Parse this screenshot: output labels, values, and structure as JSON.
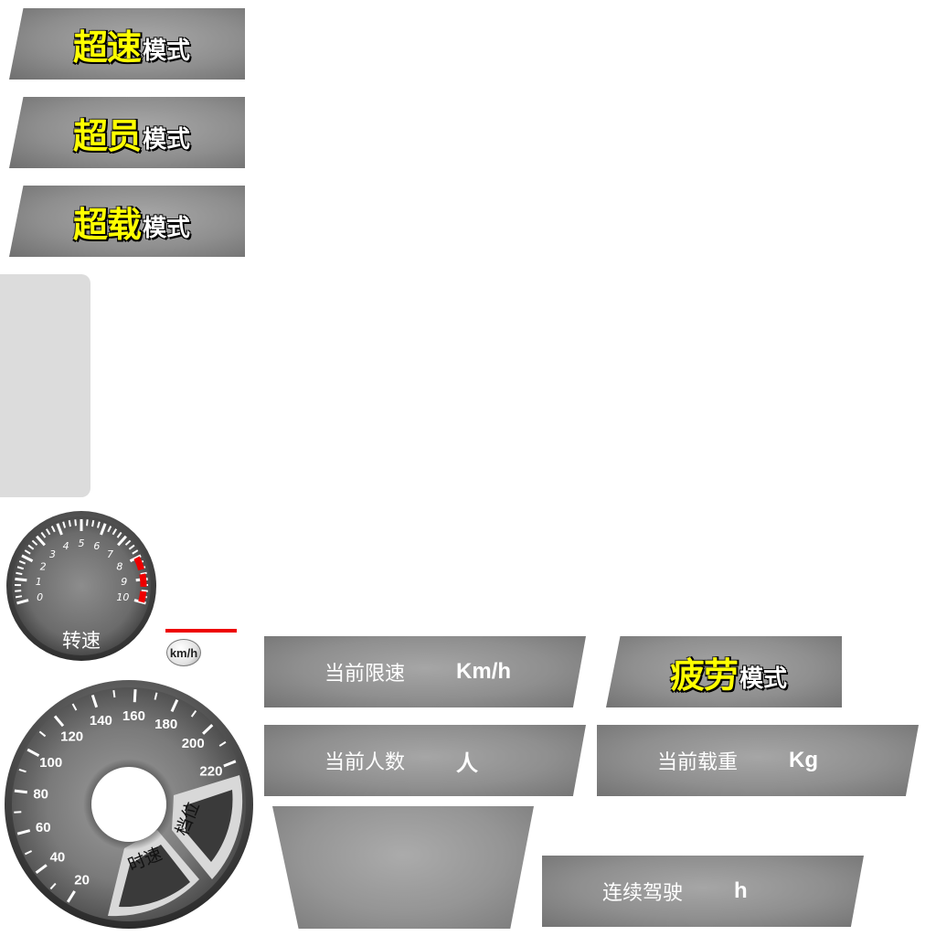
{
  "modes": [
    {
      "main": "超速",
      "sub": "模式"
    },
    {
      "main": "超员",
      "sub": "模式"
    },
    {
      "main": "超载",
      "sub": "模式"
    }
  ],
  "fatigue_mode": {
    "main": "疲劳",
    "sub": "模式"
  },
  "tachometer": {
    "label": "转速",
    "ticks": [
      "0",
      "1",
      "2",
      "3",
      "4",
      "5",
      "6",
      "7",
      "8",
      "9",
      "10"
    ],
    "redline_from": 8
  },
  "speedometer": {
    "ticks": [
      "20",
      "40",
      "60",
      "80",
      "100",
      "120",
      "140",
      "160",
      "180",
      "200",
      "220"
    ],
    "speed_label": "时速",
    "gear_label": "档位"
  },
  "unit_badge": "km/h",
  "panels": {
    "speed_limit": {
      "label": "当前限速",
      "unit": "Km/h"
    },
    "passengers": {
      "label": "当前人数",
      "unit": "人"
    },
    "load": {
      "label": "当前载重",
      "unit": "Kg"
    },
    "continuous_driving": {
      "label": "连续驾驶",
      "unit": "h"
    }
  },
  "colors": {
    "mode_text": "#ffff00",
    "redline": "#ee0000",
    "gauge_face": "#5a5a5a"
  }
}
